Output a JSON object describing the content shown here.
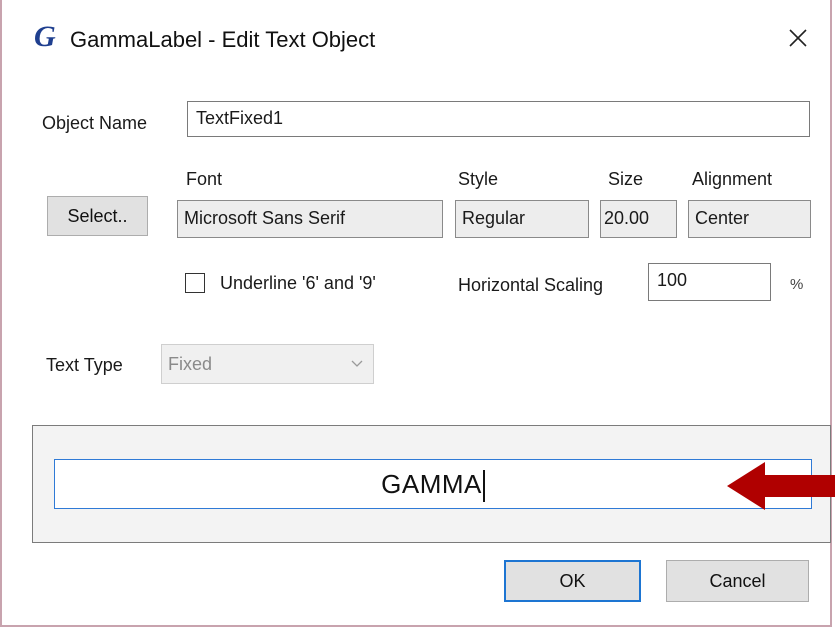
{
  "window": {
    "app_logo": "G",
    "title": "GammaLabel - Edit Text Object",
    "close_symbol": "✕"
  },
  "object_name": {
    "label": "Object Name",
    "value": "TextFixed1"
  },
  "font_section": {
    "select_button": "Select..",
    "font_header": "Font",
    "style_header": "Style",
    "size_header": "Size",
    "alignment_header": "Alignment",
    "font_value": "Microsoft Sans Serif",
    "style_value": "Regular",
    "size_value": "20.00",
    "alignment_value": "Center"
  },
  "options": {
    "underline_label": "Underline '6' and '9'",
    "underline_checked": false,
    "horizontal_scaling_label": "Horizontal Scaling",
    "horizontal_scaling_value": "100",
    "percent_symbol": "%"
  },
  "text_type": {
    "label": "Text Type",
    "selected": "Fixed"
  },
  "preview": {
    "text": "GAMMA"
  },
  "buttons": {
    "ok": "OK",
    "cancel": "Cancel"
  },
  "colors": {
    "logo": "#1f3f8f",
    "focus_border": "#2f7ad6",
    "annotation_arrow": "#b00000"
  },
  "icons": {
    "close": "close-icon",
    "dropdown": "chevron-down-icon",
    "annotation": "arrow-left-icon"
  }
}
